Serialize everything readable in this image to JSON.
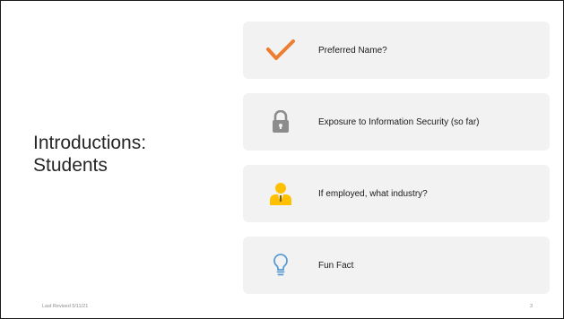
{
  "slide": {
    "title_line1": "Introductions:",
    "title_line2": "Students",
    "items": [
      {
        "label": "Preferred Name?",
        "icon": "checkmark-icon"
      },
      {
        "label": "Exposure to Information Security (so far)",
        "icon": "lock-icon"
      },
      {
        "label": "If employed, what industry?",
        "icon": "worker-icon"
      },
      {
        "label": "Fun Fact",
        "icon": "lightbulb-icon"
      }
    ],
    "footer_revised": "Last Revised 5/11/21",
    "page_number": "3"
  },
  "colors": {
    "card_background": "#f2f2f2",
    "check_orange": "#ed7d31",
    "lock_gray": "#8c8c8c",
    "worker_yellow": "#ffc000",
    "bulb_blue": "#5b9bd5"
  }
}
